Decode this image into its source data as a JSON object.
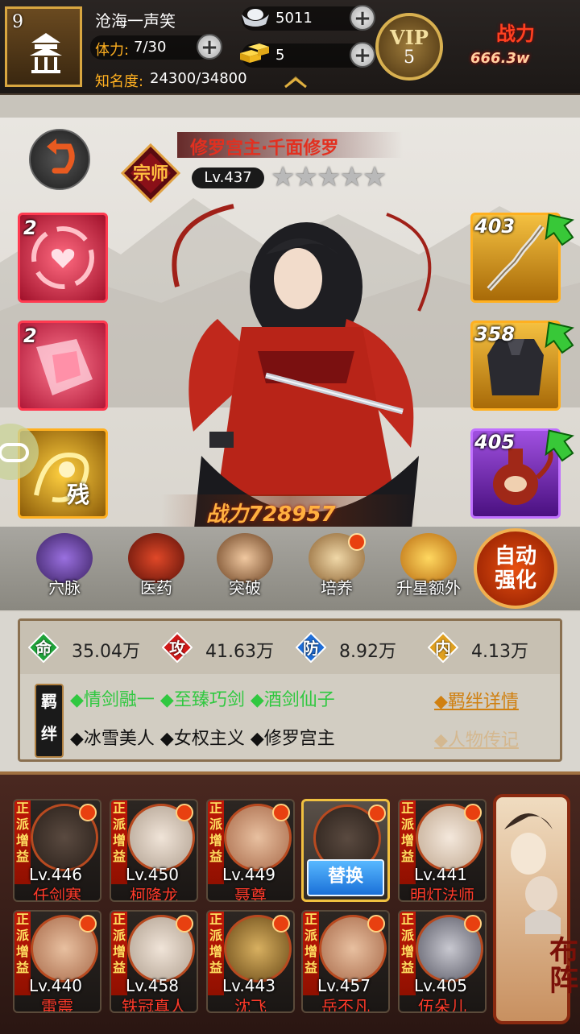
{
  "player": {
    "level": "9",
    "name": "沧海一声笑",
    "stamina_label": "体力:",
    "stamina_value": "7/30",
    "fame_label": "知名度:",
    "fame_value": "24300/34800"
  },
  "currency": {
    "silver": "5011",
    "gold": "5"
  },
  "vip": {
    "label": "VIP",
    "level": "5"
  },
  "top_power": {
    "label": "战力",
    "value": "666.3w"
  },
  "hero": {
    "name": "修罗宫主·千面修罗",
    "badge_text": "宗师",
    "level": "Lv.437",
    "stars": "★★★★★",
    "power": "战力728957"
  },
  "skills": [
    {
      "count": "2"
    },
    {
      "count": "2"
    },
    {
      "count": "",
      "mark": "残"
    }
  ],
  "equipment": [
    {
      "count": "403"
    },
    {
      "count": "358"
    },
    {
      "count": "405"
    }
  ],
  "functions": [
    {
      "label": "穴脉"
    },
    {
      "label": "医药"
    },
    {
      "label": "突破"
    },
    {
      "label": "培养"
    },
    {
      "label": "升星额外"
    }
  ],
  "auto_enhance": {
    "line1": "自动",
    "line2": "强化"
  },
  "attributes": [
    {
      "key": "命",
      "value": "35.04万",
      "color": "#1fa43a"
    },
    {
      "key": "攻",
      "value": "41.63万",
      "color": "#d01818"
    },
    {
      "key": "防",
      "value": "8.92万",
      "color": "#1f6ed8"
    },
    {
      "key": "内",
      "value": "4.13万",
      "color": "#e0a020"
    }
  ],
  "bonds": {
    "tag": "羁绊",
    "active": "◆情剑融一 ◆至臻巧剑 ◆酒剑仙子",
    "inactive": "◆冰雪美人 ◆女权主义 ◆修罗宫主",
    "detail_link": "◆羁绊详情",
    "bio_link": "◆人物传记"
  },
  "team": {
    "buff_label": "正派增益",
    "swap_label": "替换",
    "formation_label": "布阵",
    "members": [
      {
        "level": "Lv.446",
        "name": "任剑寒"
      },
      {
        "level": "Lv.450",
        "name": "柯降龙"
      },
      {
        "level": "Lv.449",
        "name": "聂尊"
      },
      {
        "level": "",
        "name": ""
      },
      {
        "level": "Lv.441",
        "name": "明灯法师"
      },
      {
        "level": "Lv.440",
        "name": "雷震"
      },
      {
        "level": "Lv.458",
        "name": "铁冠真人"
      },
      {
        "level": "Lv.443",
        "name": "沈飞"
      },
      {
        "level": "Lv.457",
        "name": "岳不凡"
      },
      {
        "level": "Lv.405",
        "name": "伍朵儿"
      }
    ]
  }
}
